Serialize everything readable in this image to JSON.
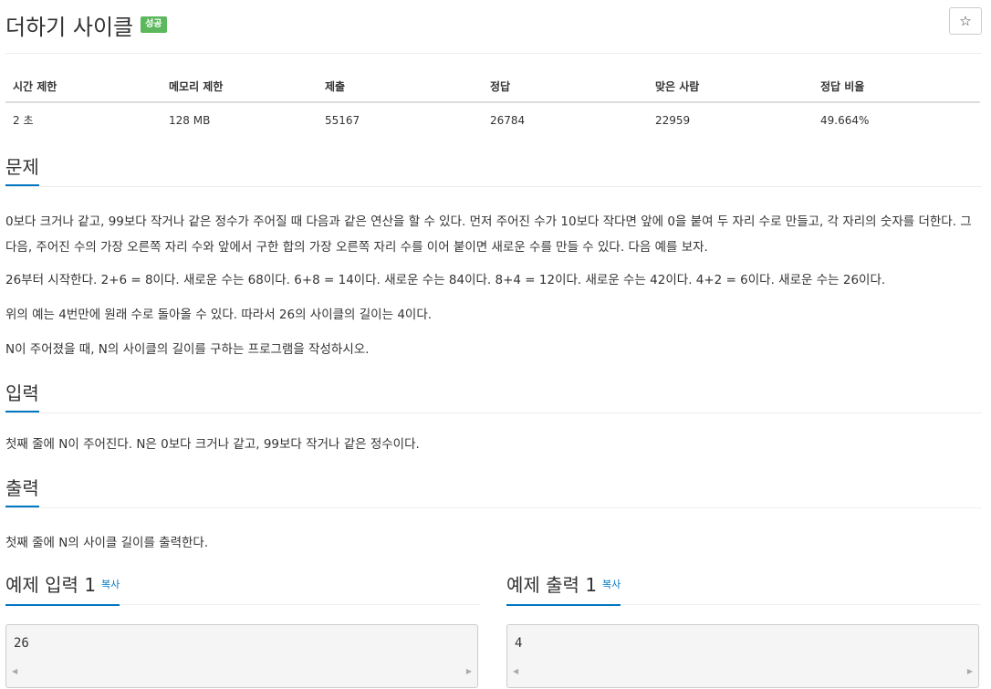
{
  "header": {
    "title": "더하기 사이클",
    "status_badge": "성공",
    "star_icon": "☆"
  },
  "info_table": {
    "headers": [
      "시간 제한",
      "메모리 제한",
      "제출",
      "정답",
      "맞은 사람",
      "정답 비율"
    ],
    "values": [
      "2 초",
      "128 MB",
      "55167",
      "26784",
      "22959",
      "49.664%"
    ]
  },
  "problem": {
    "title": "문제",
    "paragraphs": [
      "0보다 크거나 같고, 99보다 작거나 같은 정수가 주어질 때 다음과 같은 연산을 할 수 있다. 먼저 주어진 수가 10보다 작다면 앞에 0을 붙여 두 자리 수로 만들고, 각 자리의 숫자를 더한다. 그 다음, 주어진 수의 가장 오른쪽 자리 수와 앞에서 구한 합의 가장 오른쪽 자리 수를 이어 붙이면 새로운 수를 만들 수 있다. 다음 예를 보자.",
      "26부터 시작한다. 2+6 = 8이다. 새로운 수는 68이다. 6+8 = 14이다. 새로운 수는 84이다. 8+4 = 12이다. 새로운 수는 42이다. 4+2 = 6이다. 새로운 수는 26이다.",
      "위의 예는 4번만에 원래 수로 돌아올 수 있다. 따라서 26의 사이클의 길이는 4이다.",
      "N이 주어졌을 때, N의 사이클의 길이를 구하는 프로그램을 작성하시오."
    ]
  },
  "input": {
    "title": "입력",
    "text": "첫째 줄에 N이 주어진다. N은 0보다 크거나 같고, 99보다 작거나 같은 정수이다."
  },
  "output": {
    "title": "출력",
    "text": "첫째 줄에 N의 사이클 길이를 출력한다."
  },
  "samples": {
    "input_title": "예제 입력 1",
    "output_title": "예제 출력 1",
    "copy_label": "복사",
    "input_value": "26",
    "output_value": "4",
    "scroll_left": "◀",
    "scroll_right": "▶"
  }
}
